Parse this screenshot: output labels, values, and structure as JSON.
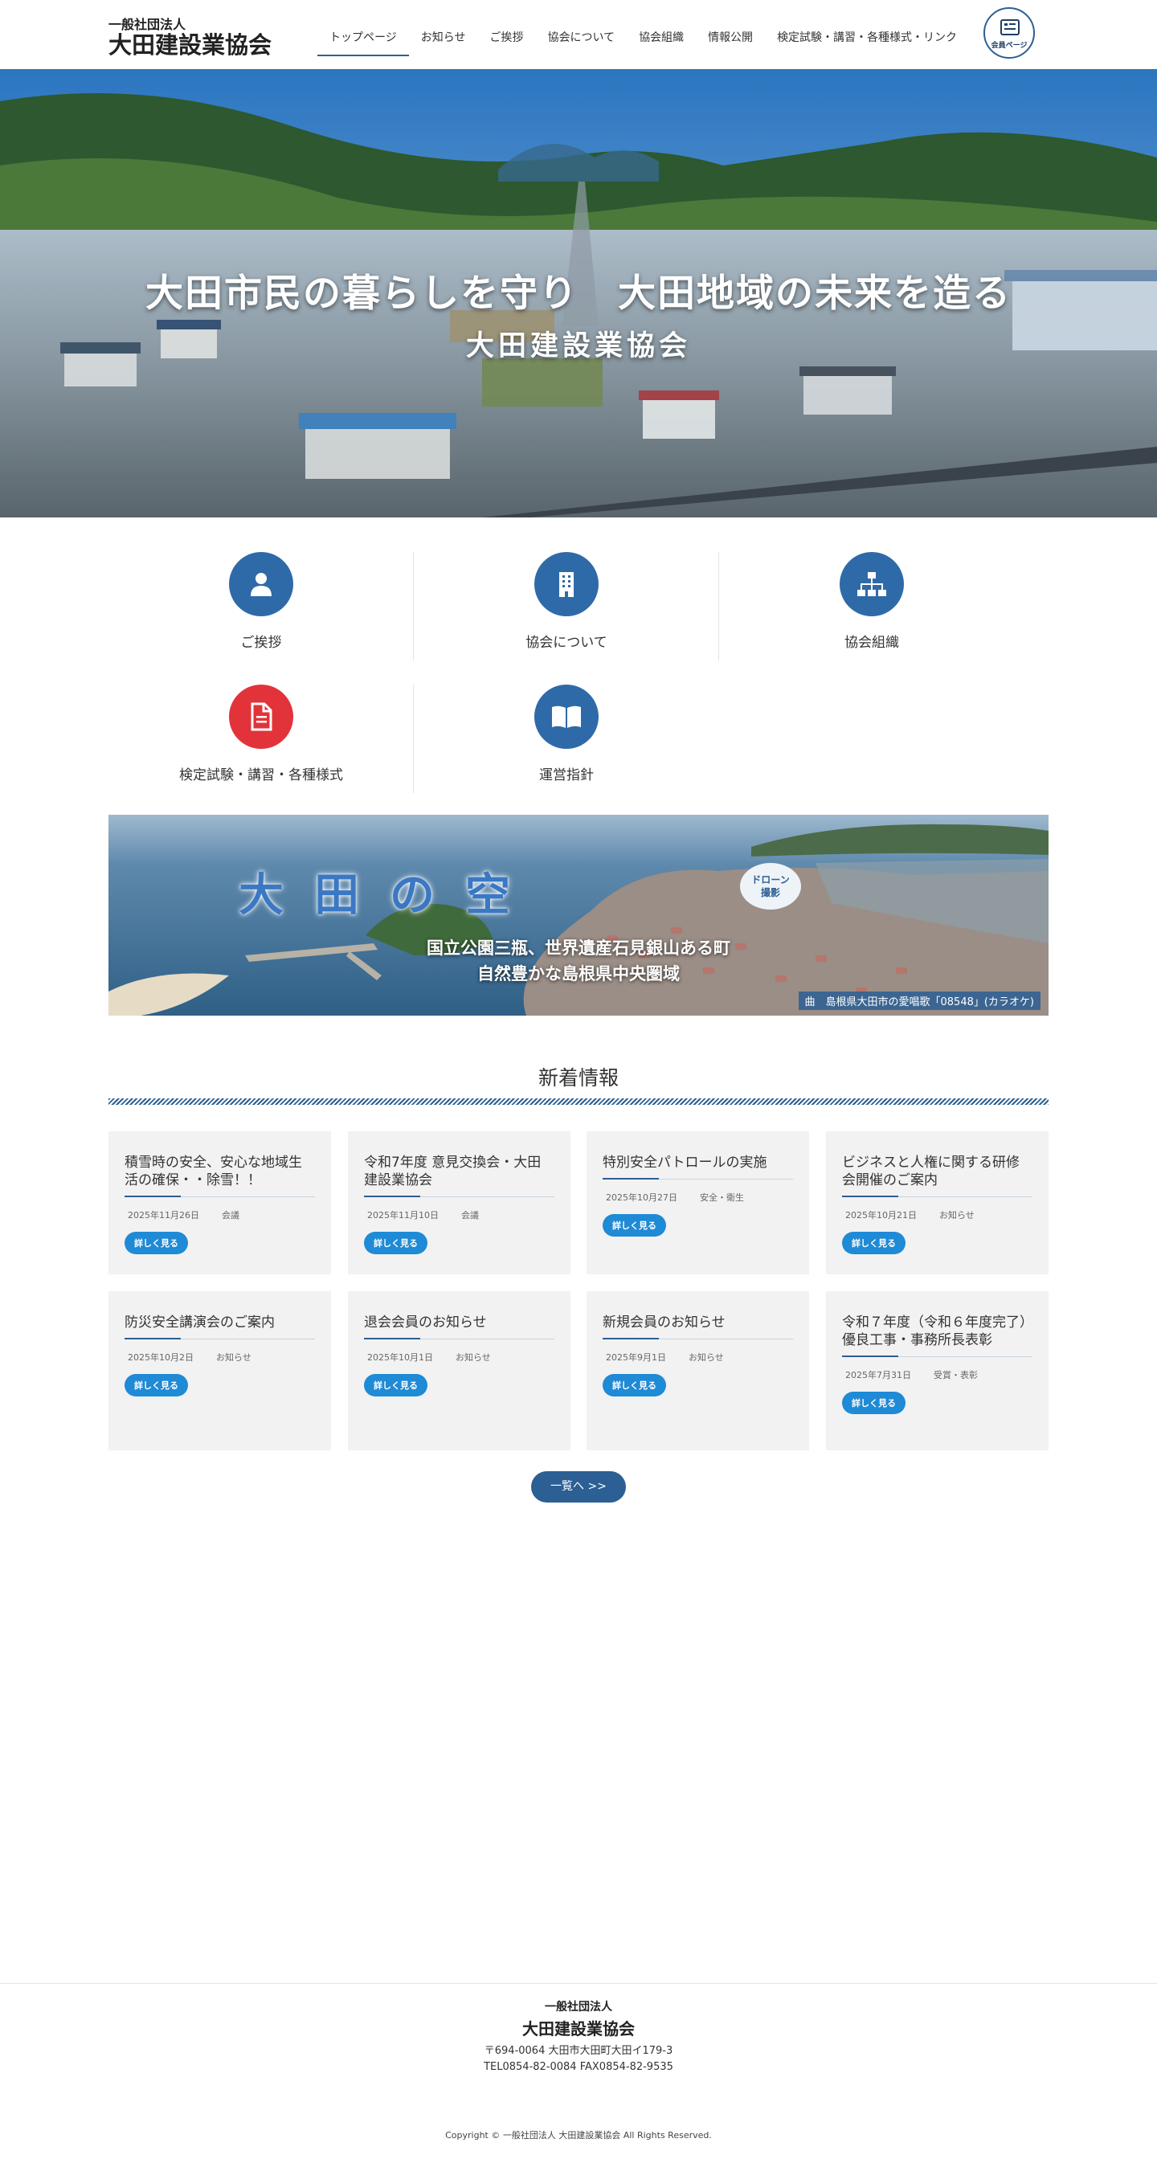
{
  "header": {
    "logo_sub": "一般社団法人",
    "logo_main": "大田建設業協会",
    "nav": [
      {
        "label": "トップページ",
        "active": true
      },
      {
        "label": "お知らせ"
      },
      {
        "label": "ご挨拶"
      },
      {
        "label": "協会について"
      },
      {
        "label": "協会組織"
      },
      {
        "label": "情報公開"
      },
      {
        "label": "検定試験・講習・各種様式・リンク"
      }
    ],
    "member_label": "会員ページ",
    "accent": "#2c5f93"
  },
  "hero": {
    "title": "大田市民の暮らしを守り　大田地域の未来を造る",
    "subtitle": "大田建設業協会"
  },
  "quick_links": [
    {
      "label": "ご挨拶",
      "icon": "person-icon",
      "color": "#2f6aa8"
    },
    {
      "label": "協会について",
      "icon": "building-icon",
      "color": "#2f6aa8"
    },
    {
      "label": "協会組織",
      "icon": "org-chart-icon",
      "color": "#2f6aa8"
    },
    {
      "label": "検定試験・講習・各種様式",
      "icon": "document-icon",
      "color": "#e2333a"
    },
    {
      "label": "運営指針",
      "icon": "book-icon",
      "color": "#2f6aa8"
    }
  ],
  "sky_banner": {
    "title": "大田の空",
    "badge": "ドローン撮影",
    "badge_line1": "ドローン",
    "badge_line2": "撮影",
    "line1": "国立公園三瓶、世界遺産石見銀山ある町",
    "line2": "自然豊かな島根県中央圏域",
    "song": "曲　島根県大田市の愛唱歌「08548」(カラオケ)"
  },
  "news": {
    "heading": "新着情報",
    "button_label": "詳しく見る",
    "items": [
      {
        "title": "積雪時の安全、安心な地域生活の確保・・除雪！！",
        "date": "2025年11月26日",
        "category": "会議"
      },
      {
        "title": "令和7年度 意見交換会・大田建設業協会",
        "date": "2025年11月10日",
        "category": "会議"
      },
      {
        "title": "特別安全パトロールの実施",
        "date": "2025年10月27日",
        "category": "安全・衛生"
      },
      {
        "title": "ビジネスと人権に関する研修会開催のご案内",
        "date": "2025年10月21日",
        "category": "お知らせ"
      },
      {
        "title": "防災安全講演会のご案内",
        "date": "2025年10月2日",
        "category": "お知らせ"
      },
      {
        "title": "退会会員のお知らせ",
        "date": "2025年10月1日",
        "category": "お知らせ"
      },
      {
        "title": "新規会員のお知らせ",
        "date": "2025年9月1日",
        "category": "お知らせ"
      },
      {
        "title": "令和７年度（令和６年度完了）優良工事・事務所長表彰",
        "date": "2025年7月31日",
        "category": "受賞・表彰"
      }
    ],
    "list_label": "一覧へ >>"
  },
  "footer": {
    "org_sub": "一般社団法人",
    "org_name": "大田建設業協会",
    "address": "〒694-0064 大田市大田町大田イ179-3",
    "tel": "TEL0854-82-0084 FAX0854-82-9535",
    "copyright": "Copyright © 一般社団法人 大田建設業協会 All Rights Reserved."
  }
}
